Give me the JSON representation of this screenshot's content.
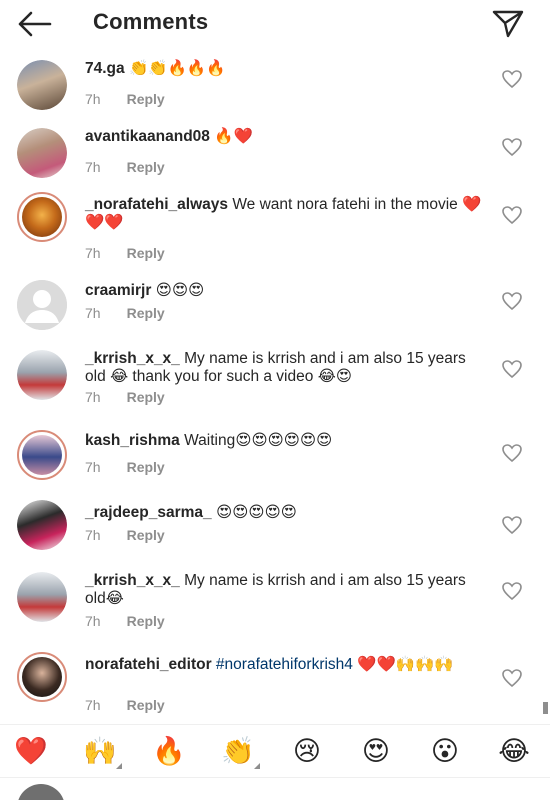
{
  "header": {
    "title": "Comments",
    "back_icon": "arrow-left-icon",
    "send_icon": "paper-plane-icon"
  },
  "comments": [
    {
      "username": "74.ga",
      "text": "👏👏🔥🔥🔥",
      "time": "7h",
      "reply": "Reply"
    },
    {
      "username": "avantikaanand08",
      "text": "🔥❤️",
      "time": "7h",
      "reply": "Reply"
    },
    {
      "username": "_norafatehi_always",
      "text": "We want nora fatehi in the movie ❤️❤️❤️",
      "time": "7h",
      "reply": "Reply"
    },
    {
      "username": "craamirjr",
      "text": "😍😍😍",
      "time": "7h",
      "reply": "Reply"
    },
    {
      "username": "_krrish_x_x_",
      "text": "My name is krrish and i am also 15 years old 😂 thank you for such a video 😂😍",
      "time": "7h",
      "reply": "Reply"
    },
    {
      "username": "kash_rishma",
      "text": "Waiting😍😍😍😍😍😍",
      "time": "7h",
      "reply": "Reply"
    },
    {
      "username": "_rajdeep_sarma_",
      "text": "😍😍😍😍😍",
      "time": "7h",
      "reply": "Reply"
    },
    {
      "username": "_krrish_x_x_",
      "text": "My name is krrish and i am also 15 years old😂",
      "time": "7h",
      "reply": "Reply"
    },
    {
      "username": "norafatehi_editor",
      "hashtag": "#norafatehiforkrish4",
      "text": "❤️❤️🙌🙌🙌",
      "time": "7h",
      "reply": "Reply"
    }
  ],
  "quick_reactions": [
    "❤️",
    "🙌",
    "🔥",
    "👏",
    "😢",
    "😍",
    "😮",
    "😂"
  ],
  "composer": {
    "placeholder": ""
  },
  "colors": {
    "text": "#262626",
    "meta": "#8e8e8e",
    "hashtag": "#00376b",
    "story_ring": "#d98b78"
  }
}
